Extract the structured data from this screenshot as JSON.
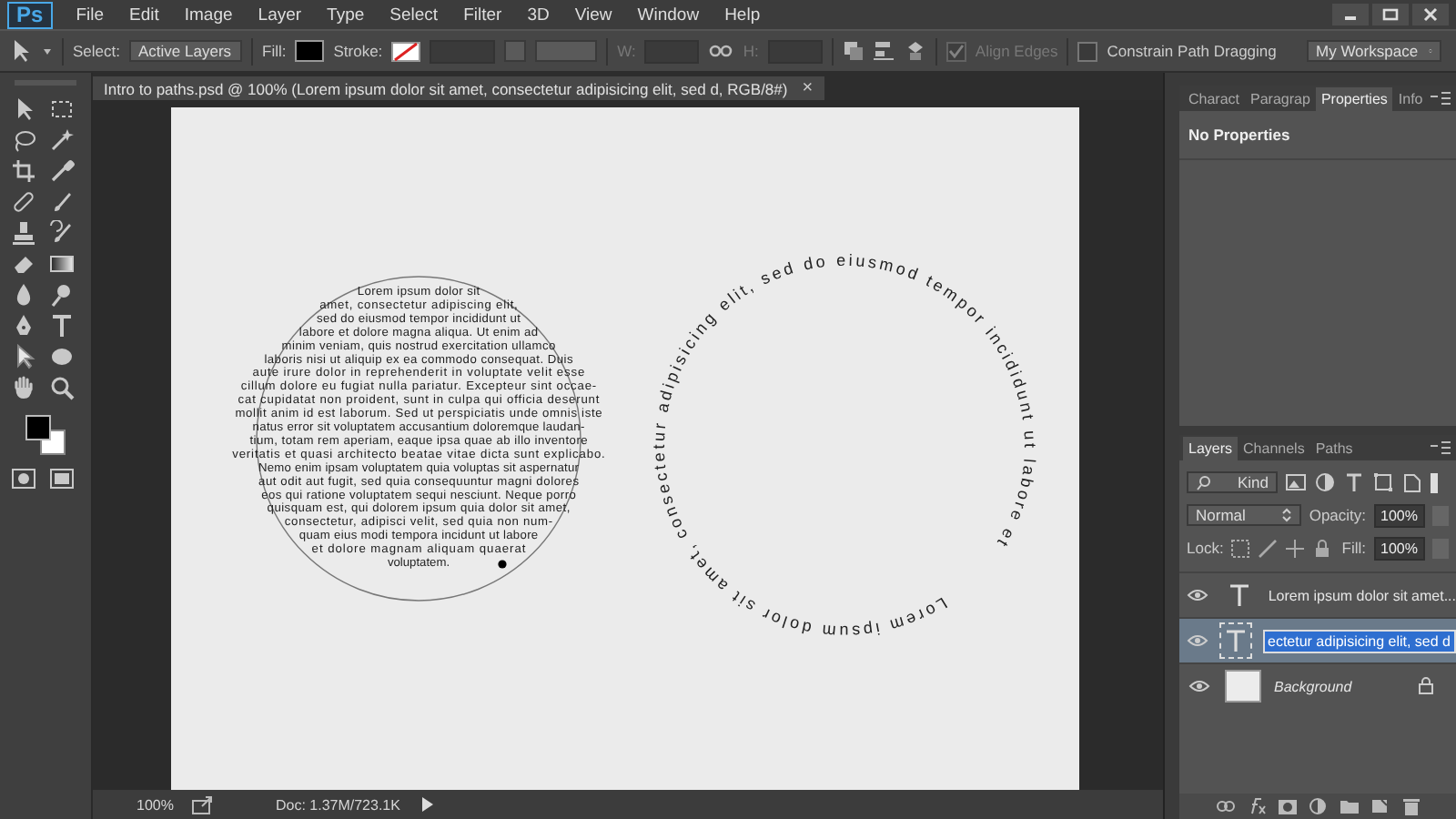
{
  "app_logo": "Ps",
  "menu": [
    "File",
    "Edit",
    "Image",
    "Layer",
    "Type",
    "Select",
    "Filter",
    "3D",
    "View",
    "Window",
    "Help"
  ],
  "options_bar": {
    "select_label": "Select:",
    "select_value": "Active Layers",
    "fill_label": "Fill:",
    "stroke_label": "Stroke:",
    "w_label": "W:",
    "h_label": "H:",
    "align_edges": {
      "label": "Align Edges",
      "checked": true,
      "disabled": true
    },
    "constrain": {
      "label": "Constrain Path Dragging",
      "checked": false,
      "disabled": false
    },
    "workspace": "My Workspace"
  },
  "document_tab": {
    "title": "Intro to paths.psd @ 100% (Lorem ipsum dolor sit amet, consectetur adipisicing elit, sed d, RGB/8#)",
    "close": "×"
  },
  "canvas": {
    "paragraph_lines": [
      "Lorem ipsum dolor sit",
      "amet, consectetur adipiscing elit,",
      "sed do eiusmod tempor incididunt ut",
      "labore et dolore magna aliqua. Ut enim ad",
      "minim veniam, quis nostrud exercitation ullamco",
      "laboris nisi ut aliquip ex ea commodo consequat. Duis",
      "aute irure dolor in reprehenderit in voluptate velit esse",
      "cillum dolore eu fugiat nulla pariatur. Excepteur sint occae-",
      "cat cupidatat non proident, sunt in culpa qui officia deserunt",
      "mollit anim id est laborum. Sed ut perspiciatis unde omnis iste",
      "natus error sit voluptatem accusantium doloremque laudan-",
      "tium, totam rem aperiam, eaque ipsa quae ab illo inventore",
      "veritatis et quasi architecto beatae vitae dicta sunt explicabo.",
      "Nemo enim ipsam voluptatem quia voluptas sit aspernatur",
      "aut odit aut fugit, sed quia consequuntur magni dolores",
      "eos qui ratione voluptatem sequi nesciunt. Neque porro",
      "quisquam est, qui dolorem ipsum quia dolor sit amet,",
      "consectetur, adipisci velit, sed quia non num-",
      "quam eius modi tempora incidunt ut labore",
      "et dolore magnam aliquam quaerat",
      "voluptatem."
    ],
    "path_text": "Lorem ipsum dolor sit amet, consectetur adipisicing elit, sed do eiusmod tempor incididunt ut labore et"
  },
  "status_bar": {
    "zoom": "100%",
    "doc_size": "Doc: 1.37M/723.1K"
  },
  "properties_panel": {
    "tabs": [
      {
        "label": "Charact",
        "selected": false
      },
      {
        "label": "Paragrap",
        "selected": false
      },
      {
        "label": "Properties",
        "selected": true
      },
      {
        "label": "Info",
        "selected": false
      }
    ],
    "message": "No Properties"
  },
  "layers_panel": {
    "tabs": [
      {
        "label": "Layers",
        "selected": true
      },
      {
        "label": "Channels",
        "selected": false
      },
      {
        "label": "Paths",
        "selected": false
      }
    ],
    "filter": "Kind",
    "blend_mode": "Normal",
    "opacity_label": "Opacity:",
    "opacity": "100%",
    "lock_label": "Lock:",
    "fill_label": "Fill:",
    "fill": "100%",
    "layers": [
      {
        "name": "Lorem ipsum dolor sit amet...",
        "kind": "text",
        "selected": false,
        "editing": false,
        "visible": true,
        "locked": false
      },
      {
        "name": "ectetur adipisicing elit, sed d",
        "kind": "text",
        "selected": true,
        "editing": true,
        "visible": true,
        "locked": false
      },
      {
        "name": "Background",
        "kind": "background",
        "selected": false,
        "editing": false,
        "visible": true,
        "locked": true
      }
    ]
  }
}
